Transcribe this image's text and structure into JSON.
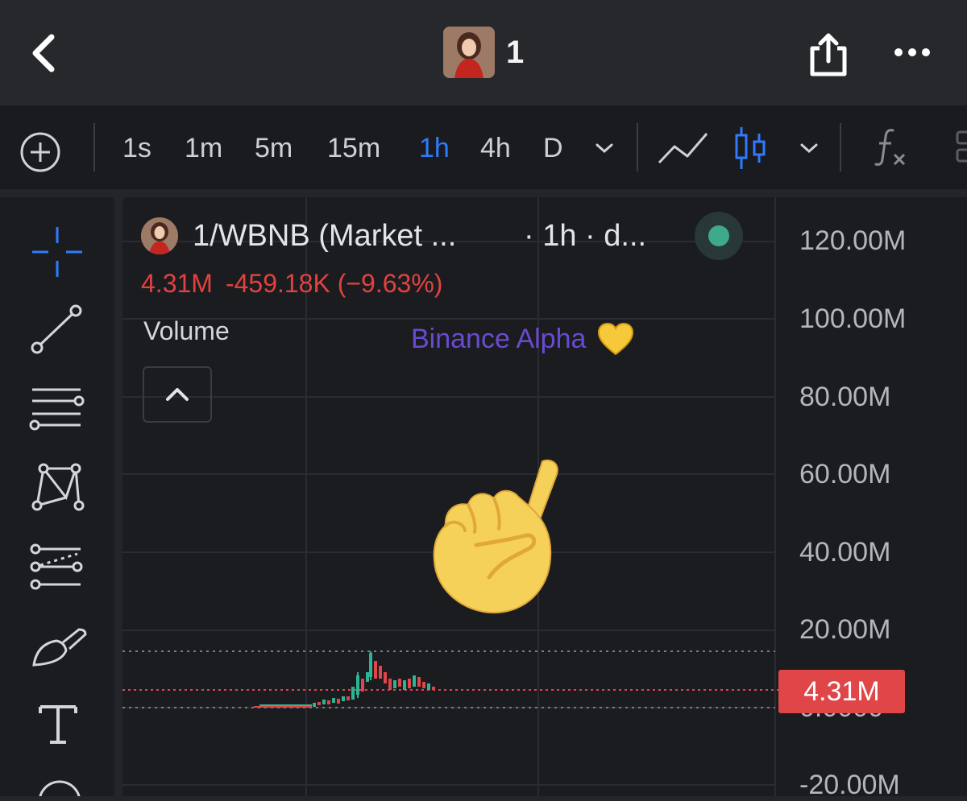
{
  "header": {
    "title": "1",
    "back_icon": "chevron-left-icon",
    "share_icon": "share-icon",
    "more_icon": "more-dots-icon"
  },
  "toolbar": {
    "timeframes": [
      "1s",
      "1m",
      "5m",
      "15m",
      "1h",
      "4h",
      "D"
    ],
    "active_timeframe": "1h",
    "accent_color": "#2f7bff"
  },
  "chart": {
    "symbol": "1/WBNB (Market ...",
    "interval": "· 1h · d...",
    "price": "4.31M",
    "change": "-459.18K (−9.63%)",
    "indicator": "Volume",
    "watermark": "Binance Alpha",
    "status_color": "#3fa98b",
    "down_color": "#e04548",
    "up_color": "#2eb495"
  },
  "y_axis": {
    "labels": [
      "120.00M",
      "100.00M",
      "80.00M",
      "60.00M",
      "40.00M",
      "20.00M",
      "0.0000",
      "-20.00M"
    ]
  },
  "current_price_label": "4.31M",
  "tools": [
    "crosshair-icon",
    "trendline-icon",
    "fib-lines-icon",
    "pattern-icon",
    "projection-icon",
    "brush-icon",
    "text-icon",
    "shape-icon"
  ]
}
